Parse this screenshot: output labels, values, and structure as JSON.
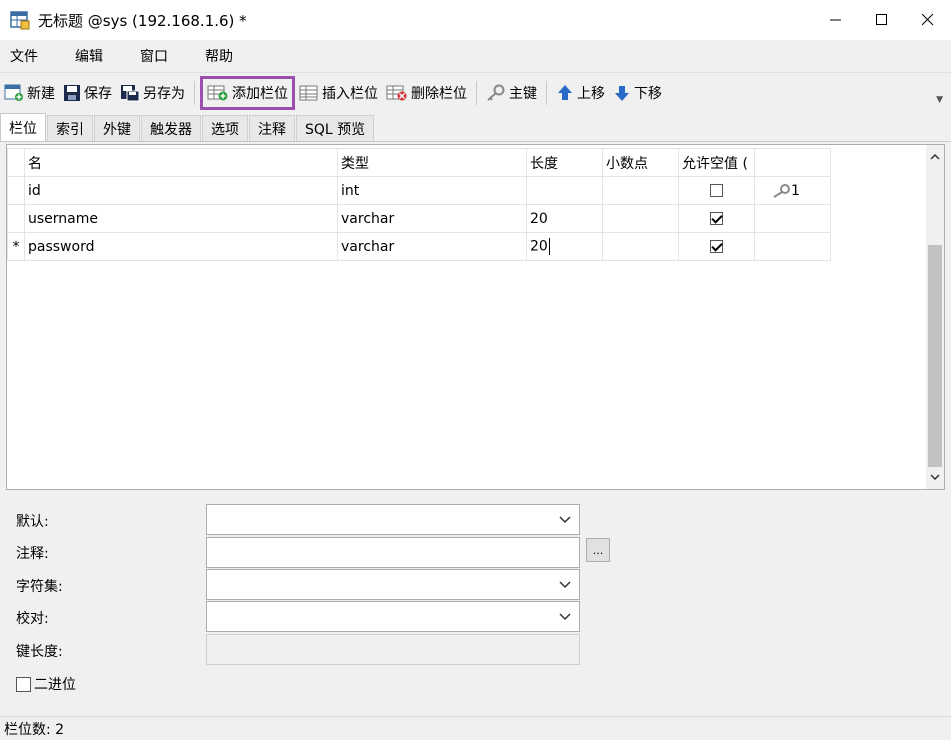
{
  "window": {
    "title": "无标题 @sys (192.168.1.6) *"
  },
  "menu": [
    "文件",
    "编辑",
    "窗口",
    "帮助"
  ],
  "toolbar": {
    "new": "新建",
    "save": "保存",
    "save_as": "另存为",
    "add_field": "添加栏位",
    "insert_field": "插入栏位",
    "delete_field": "删除栏位",
    "primary_key": "主键",
    "move_up": "上移",
    "move_down": "下移",
    "highlight_color": "#9b4fae"
  },
  "tabs": [
    "栏位",
    "索引",
    "外键",
    "触发器",
    "选项",
    "注释",
    "SQL 预览"
  ],
  "grid": {
    "headers": [
      "名",
      "类型",
      "长度",
      "小数点",
      "允许空值 (",
      ""
    ],
    "rows": [
      {
        "marker": "",
        "name": "id",
        "type": "int",
        "length": "",
        "decimals": "",
        "nullable": false,
        "key": "1"
      },
      {
        "marker": "",
        "name": "username",
        "type": "varchar",
        "length": "20",
        "decimals": "",
        "nullable": true,
        "key": ""
      },
      {
        "marker": "*",
        "name": "password",
        "type": "varchar",
        "length": "20",
        "decimals": "",
        "nullable": true,
        "key": ""
      }
    ]
  },
  "properties": {
    "default_label": "默认:",
    "comment_label": "注释:",
    "charset_label": "字符集:",
    "collation_label": "校对:",
    "key_length_label": "键长度:",
    "binary_label": "二进位",
    "ellipsis": "..."
  },
  "status": {
    "field_count": "栏位数: 2"
  }
}
